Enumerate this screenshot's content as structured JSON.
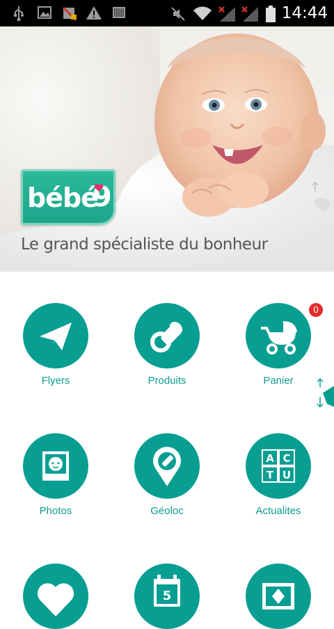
{
  "status_bar": {
    "time": "14:44",
    "icons": [
      "usb-icon",
      "image-icon",
      "mobile-data-off-icon",
      "warning-icon",
      "barcode-icon",
      "vibrate-icon",
      "wifi-icon",
      "signal-icon-1",
      "signal-icon-2",
      "battery-icon"
    ]
  },
  "hero": {
    "logo_text": "bébé",
    "logo_number": "9",
    "tagline": "Le grand spécialiste du bonheur"
  },
  "menu": {
    "items": [
      {
        "label": "Flyers",
        "icon": "paper-plane-icon"
      },
      {
        "label": "Produits",
        "icon": "pacifier-icon"
      },
      {
        "label": "Panier",
        "icon": "stroller-icon",
        "badge": "0"
      },
      {
        "label": "Photos",
        "icon": "baby-photo-icon"
      },
      {
        "label": "Géoloc",
        "icon": "location-bottle-icon"
      },
      {
        "label": "Actualites",
        "icon": "abc-blocks-icon"
      },
      {
        "label": "",
        "icon": "heart-icon"
      },
      {
        "label": "",
        "icon": "calendar-icon"
      },
      {
        "label": "",
        "icon": "photo-frame-icon"
      }
    ]
  },
  "colors": {
    "accent": "#089e92",
    "badge": "#e52b2b",
    "logo": "#1ea58b"
  }
}
